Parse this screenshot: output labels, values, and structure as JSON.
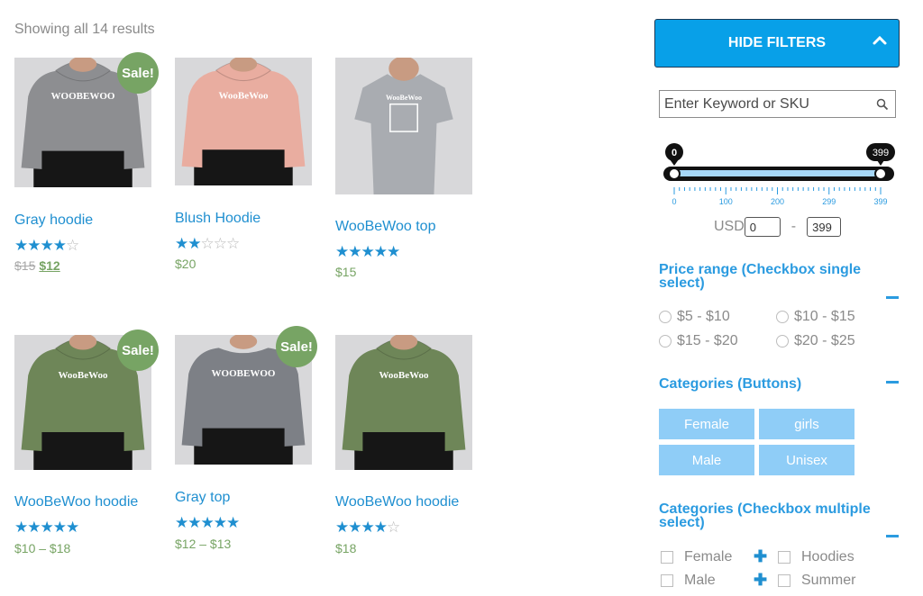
{
  "results_count": "Showing all 14 results",
  "sale_label": "Sale!",
  "products": [
    {
      "title": "Gray hoodie",
      "rating": 4,
      "price_old": "$15",
      "price_new": "$12",
      "price": "",
      "sale": true,
      "garment": "hoodie",
      "shirt_color": "#8d8e91",
      "print": "WOOBEWOO"
    },
    {
      "title": "Blush Hoodie",
      "rating": 2,
      "price": "$20",
      "sale": false,
      "garment": "hoodie",
      "shirt_color": "#e9ada0",
      "print": "WooBeWoo"
    },
    {
      "title": "WooBeWoo top",
      "rating": 5,
      "price": "$15",
      "sale": false,
      "garment": "tshirt",
      "shirt_color": "#a9acb1",
      "print": "WooBeWoo"
    },
    {
      "title": "WooBeWoo hoodie",
      "rating": 5,
      "price": "$10 – $18",
      "sale": true,
      "garment": "hoodie",
      "shirt_color": "#6e8658",
      "print": "WooBeWoo"
    },
    {
      "title": "Gray top",
      "rating": 5,
      "price": "$12 – $13",
      "sale": true,
      "garment": "sweater",
      "shirt_color": "#7d8086",
      "print": "WOOBEWOO"
    },
    {
      "title": "WooBeWoo hoodie",
      "rating": 4,
      "price": "$18",
      "sale": false,
      "garment": "hoodie",
      "shirt_color": "#6e8658",
      "print": "WooBeWoo"
    }
  ],
  "filters": {
    "hide_label": "HIDE FILTERS",
    "search_placeholder": "Enter Keyword or SKU",
    "slider": {
      "min": 0,
      "max": 399,
      "min_label": "0",
      "max_label": "399",
      "ticks": [
        "0",
        "100",
        "200",
        "299",
        "399"
      ]
    },
    "currency": "USD",
    "price_min": "0",
    "price_max": "399",
    "price_range_title": "Price range (Checkbox single select)",
    "price_ranges": [
      "$5 - $10",
      "$10 - $15",
      "$15 - $20",
      "$20 - $25"
    ],
    "categories_buttons_title": "Categories (Buttons)",
    "category_buttons": [
      "Female",
      "girls",
      "Male",
      "Unisex"
    ],
    "categories_checkbox_title": "Categories (Checkbox multiple select)",
    "category_checkboxes": [
      "Female",
      "Hoodies",
      "Male",
      "Summer"
    ]
  },
  "colors": {
    "accent": "#1f8fd0",
    "button": "#08a0e8",
    "sale": "#77a464",
    "category_button": "#8fcdf7"
  }
}
